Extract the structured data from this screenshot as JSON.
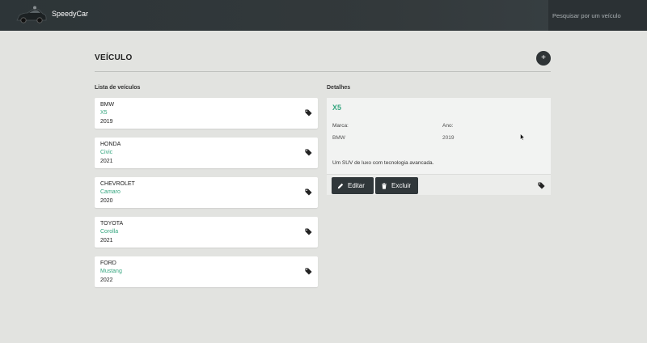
{
  "header": {
    "brand": "SpeedyCar",
    "search_placeholder": "Pesquisar por um veículo"
  },
  "page": {
    "title": "VEÍCULO",
    "add_label": "+"
  },
  "list": {
    "title": "Lista de veículos",
    "items": [
      {
        "brand": "BMW",
        "model": "X5",
        "year": "2019"
      },
      {
        "brand": "HONDA",
        "model": "Civic",
        "year": "2021"
      },
      {
        "brand": "CHEVROLET",
        "model": "Camaro",
        "year": "2020"
      },
      {
        "brand": "TOYOTA",
        "model": "Corolla",
        "year": "2021"
      },
      {
        "brand": "FORD",
        "model": "Mustang",
        "year": "2022"
      }
    ]
  },
  "details": {
    "title": "Detalhes",
    "model": "X5",
    "brand_label": "Marca:",
    "brand_value": "BMW",
    "year_label": "Ano:",
    "year_value": "2019",
    "description": "Um SUV de luxo com tecnologia avancada.",
    "edit_label": "Editar",
    "delete_label": "Excluir"
  },
  "colors": {
    "accent": "#35a67f",
    "topbar": "#2d3538",
    "button": "#30373a",
    "background": "#e2e3e0"
  },
  "icons": [
    "car-logo-icon",
    "plus-icon",
    "tag-icon",
    "pencil-icon",
    "trash-icon"
  ]
}
